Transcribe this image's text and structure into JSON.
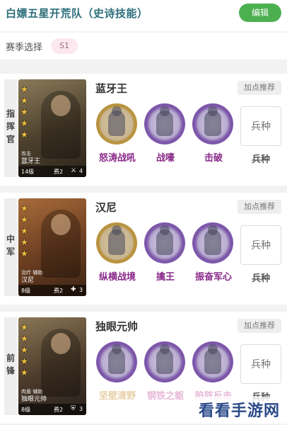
{
  "header": {
    "title": "白嫖五星开荒队（史诗技能）",
    "edit_label": "编辑",
    "accent_color": "#4caf50"
  },
  "season": {
    "label": "赛季选择",
    "value": "S1"
  },
  "slots": [
    {
      "position": "指挥官",
      "card": {
        "stars": 5,
        "role": "攻击",
        "name": "蓝牙王",
        "level": "14级",
        "cost": "费2",
        "count": "4"
      },
      "hero_name": "蓝牙王",
      "recommend_label": "加点推荐",
      "skills": [
        {
          "name": "怒涛战吼",
          "icon": "warrior-icon",
          "frame": "gold"
        },
        {
          "name": "战嚎",
          "icon": "warrior-icon",
          "frame": "purple"
        },
        {
          "name": "击破",
          "icon": "warrior-icon",
          "frame": "purple"
        }
      ],
      "troop_box": "兵种",
      "troop_label": "兵种"
    },
    {
      "position": "中军",
      "card": {
        "stars": 5,
        "role": "治疗 辅助",
        "name": "汉尼",
        "level": "8级",
        "cost": "费2",
        "count": "3"
      },
      "hero_name": "汉尼",
      "recommend_label": "加点推荐",
      "skills": [
        {
          "name": "纵横战境",
          "icon": "warrior-icon",
          "frame": "gold"
        },
        {
          "name": "擒王",
          "icon": "warrior-icon",
          "frame": "purple"
        },
        {
          "name": "振奋军心",
          "icon": "warrior-icon",
          "frame": "purple"
        }
      ],
      "troop_box": "兵种",
      "troop_label": "兵种"
    },
    {
      "position": "前锋",
      "card": {
        "stars": 5,
        "role": "肉盾 辅助",
        "name": "独眼元帅",
        "level": "8级",
        "cost": "费2",
        "count": "3"
      },
      "hero_name": "独眼元帅",
      "recommend_label": "加点推荐",
      "skills": [
        {
          "name": "坚壁清野",
          "icon": "warrior-icon",
          "frame": "purple"
        },
        {
          "name": "钢铁之躯",
          "icon": "shield-icon",
          "frame": "purple"
        },
        {
          "name": "陷阵反击",
          "icon": "warrior-icon",
          "frame": "purple"
        }
      ],
      "troop_box": "兵种",
      "troop_label": "兵种"
    }
  ],
  "watermark": "看看手游网"
}
